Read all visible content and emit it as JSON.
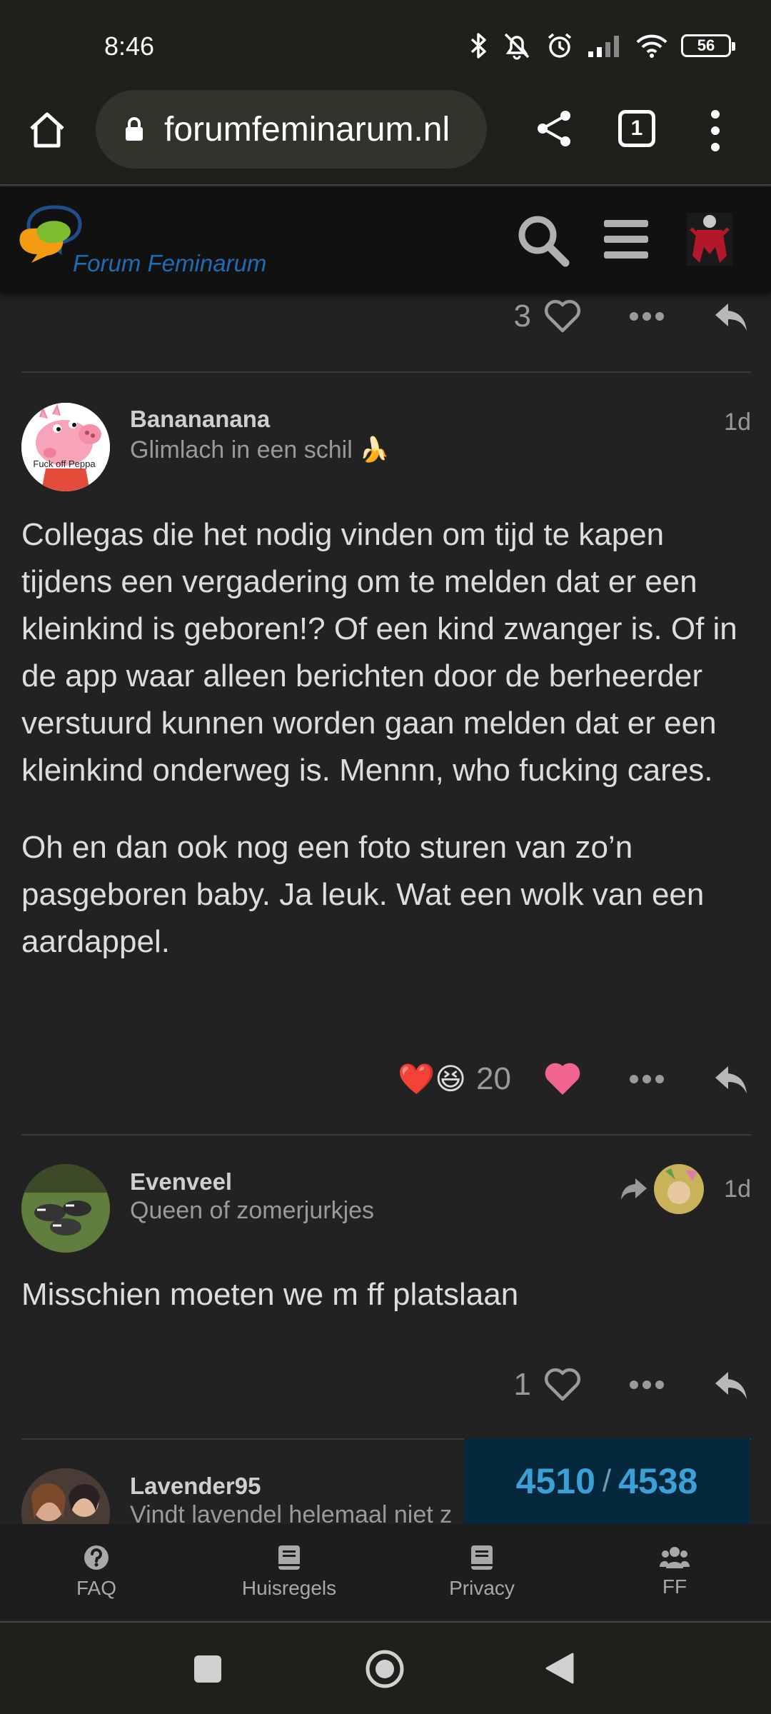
{
  "status_bar": {
    "time": "8:46",
    "battery": "56"
  },
  "browser": {
    "url": "forumfeminarum.nl",
    "tab_count": "1"
  },
  "site": {
    "logo_text": "Forum Feminarum"
  },
  "posts": [
    {
      "like_count": "3"
    },
    {
      "username": "Banananana",
      "user_title": "Glimlach in een schil 🍌",
      "age": "1d",
      "avatar_caption": "Fuck off Peppa",
      "paragraphs": [
        "Collegas die het nodig vinden om tijd te kapen tijdens een vergadering om te melden dat er een kleinkind is geboren!? Of een kind zwanger is. Of in de app waar alleen berichten door de berheerder verstuurd kunnen worden gaan melden dat er een kleinkind onderweg is. Mennn, who fucking cares.",
        "Oh en dan ook nog een foto sturen van zo’n pasgeboren baby. Ja leuk. Wat een wolk van een aardappel."
      ],
      "reactions": "❤️😆",
      "like_count": "20"
    },
    {
      "username": "Evenveel",
      "user_title": "Queen of zomerjurkjes",
      "age": "1d",
      "body": "Misschien moeten we m ff platslaan",
      "like_count": "1"
    },
    {
      "username": "Lavender95",
      "user_title": "Vindt lavendel helemaal niet z"
    }
  ],
  "progress": {
    "current": "4510",
    "separator": "/",
    "total": "4538"
  },
  "bottom_nav": [
    {
      "label": "FAQ",
      "icon": "question-circle-icon"
    },
    {
      "label": "Huisregels",
      "icon": "book-icon"
    },
    {
      "label": "Privacy",
      "icon": "book-icon"
    },
    {
      "label": "FF",
      "icon": "users-icon"
    }
  ],
  "colors": {
    "background": "#222222",
    "header": "#111111",
    "brand_blue": "#1f6cb4",
    "liked_heart": "#f0648f",
    "progress_bg": "#06283c",
    "progress_text": "#3aa0d6"
  }
}
